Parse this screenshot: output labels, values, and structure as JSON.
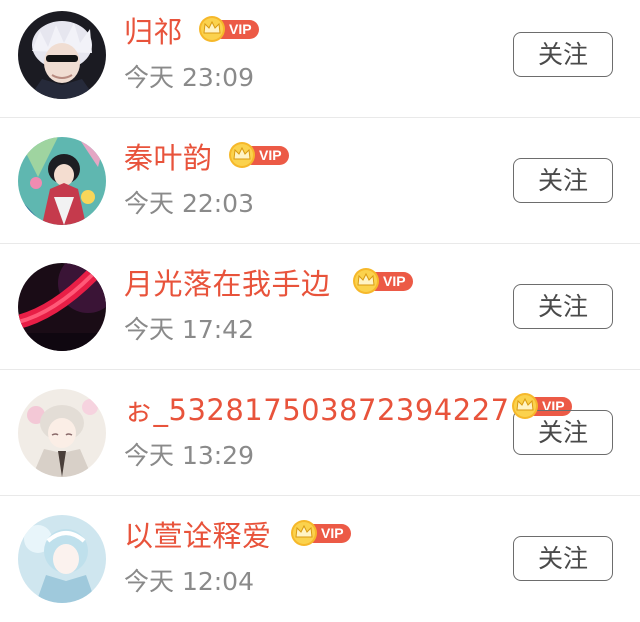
{
  "colors": {
    "name": "#e8533b",
    "time": "#8a8a8a",
    "vip_badge": "#ec5a46",
    "crown": "#f6b82a",
    "button_border": "#6d6d6d",
    "divider": "#e9e9e9"
  },
  "vip_label": "VIP",
  "follow_label": "关注",
  "users": [
    {
      "name": "归祁",
      "time": "今天 23:09",
      "vip": true,
      "avatar_icon": "avatar-white-hair-boy"
    },
    {
      "name": "秦叶韵",
      "time": "今天 22:03",
      "vip": true,
      "avatar_icon": "avatar-colorful-anime-girl"
    },
    {
      "name": "月光落在我手边",
      "time": "今天 17:42",
      "vip": true,
      "avatar_icon": "avatar-dark-red-arc"
    },
    {
      "name": "ぉ_532817503872394227",
      "time": "今天 13:29",
      "vip": true,
      "avatar_icon": "avatar-pale-anime-girl"
    },
    {
      "name": "以萱诠释爱",
      "time": "今天 12:04",
      "vip": true,
      "avatar_icon": "avatar-ice-blue-girl"
    }
  ]
}
